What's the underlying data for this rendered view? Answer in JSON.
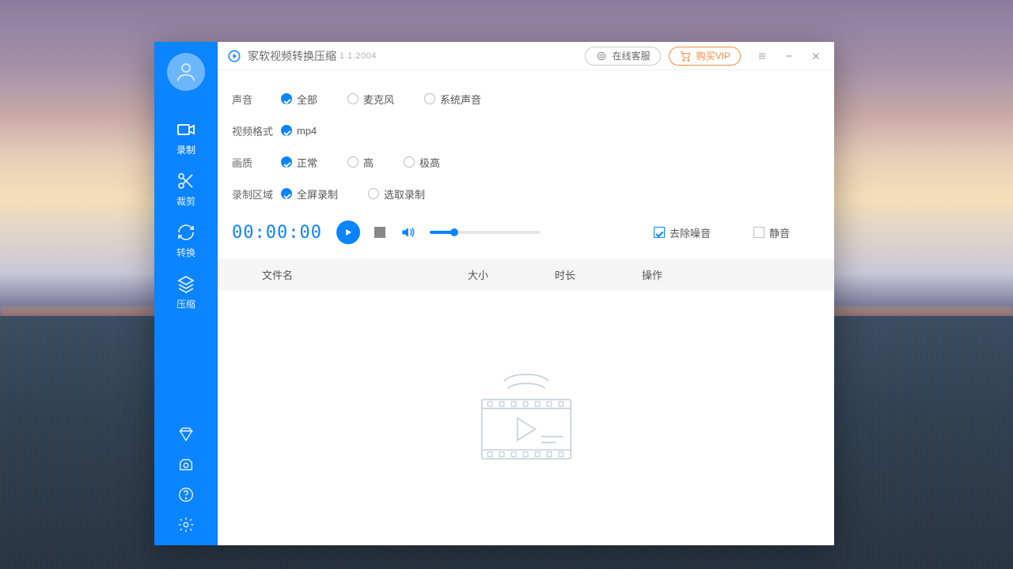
{
  "titlebar": {
    "app_name": "家软视频转换压缩",
    "version": "1.1.2004",
    "service_btn": "在线客服",
    "vip_btn": "购买VIP"
  },
  "sidebar": {
    "items": [
      {
        "label": "录制"
      },
      {
        "label": "裁剪"
      },
      {
        "label": "转换"
      },
      {
        "label": "压缩"
      }
    ]
  },
  "settings": {
    "sound": {
      "label": "声音",
      "options": [
        "全部",
        "麦克风",
        "系统声音"
      ],
      "selected": 0
    },
    "format": {
      "label": "视频格式",
      "options": [
        "mp4"
      ],
      "selected": 0
    },
    "quality": {
      "label": "画质",
      "options": [
        "正常",
        "高",
        "极高"
      ],
      "selected": 0
    },
    "area": {
      "label": "录制区域",
      "options": [
        "全屏录制",
        "选取录制"
      ],
      "selected": 0
    }
  },
  "controls": {
    "timer": "00:00:00",
    "volume_percent": 22,
    "denoise_label": "去除噪音",
    "denoise_checked": true,
    "mute_label": "静音",
    "mute_checked": false
  },
  "table": {
    "columns": [
      "文件名",
      "大小",
      "时长",
      "操作"
    ]
  },
  "colors": {
    "accent": "#0a84ff",
    "vip": "#ff8a3c"
  }
}
